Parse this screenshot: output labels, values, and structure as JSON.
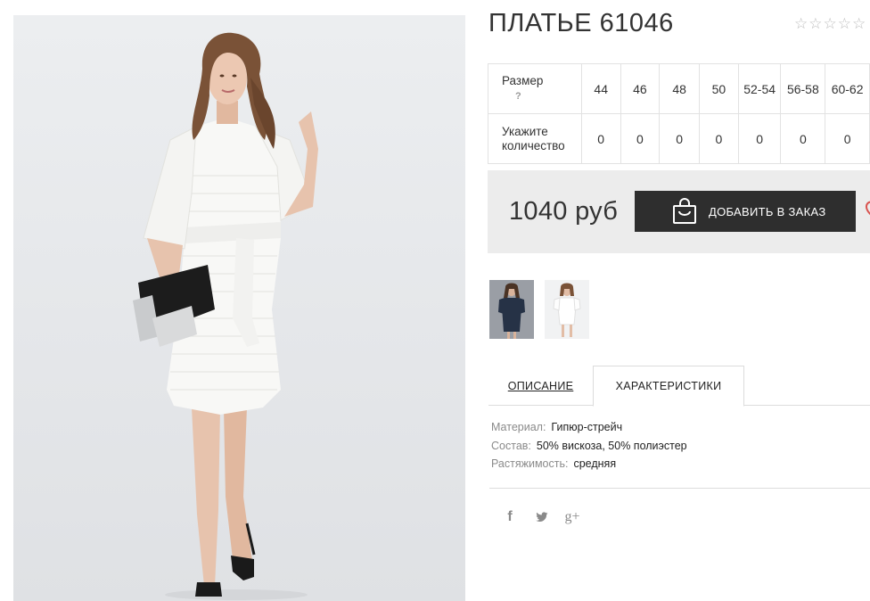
{
  "product": {
    "title": "ПЛАТЬЕ 61046",
    "rating": {
      "stars_total": 5,
      "stars_filled": 0
    }
  },
  "size_table": {
    "size_label": "Размер",
    "size_help": "?",
    "quantity_label": "Укажите количество",
    "sizes": [
      "44",
      "46",
      "48",
      "50",
      "52-54",
      "56-58",
      "60-62"
    ],
    "quantities": [
      "0",
      "0",
      "0",
      "0",
      "0",
      "0",
      "0"
    ]
  },
  "purchase": {
    "price": "1040 руб",
    "add_button_label": "ДОБАВИТЬ В ЗАКАЗ",
    "add_button_icon": "shopping-bag-icon",
    "wishlist_icon": "heart-icon"
  },
  "gallery": {
    "thumbnails": [
      "dark-blue-dress-thumbnail",
      "white-dress-thumbnail"
    ]
  },
  "tabs": [
    {
      "label": "ОПИСАНИЕ",
      "active": false
    },
    {
      "label": "ХАРАКТЕРИСТИКИ",
      "active": true
    }
  ],
  "characteristics": [
    {
      "key": "Материал:",
      "value": "Гипюр-стрейч"
    },
    {
      "key": "Состав:",
      "value": "50% вискоза, 50% полиэстер"
    },
    {
      "key": "Растяжимость:",
      "value": "средняя"
    }
  ],
  "social": {
    "facebook": "f",
    "twitter_icon": "twitter-icon",
    "google_plus": "g+"
  },
  "colors": {
    "button_bg": "#2e2e2e",
    "panel_bg": "#ececec",
    "border": "#e2e2e2"
  }
}
